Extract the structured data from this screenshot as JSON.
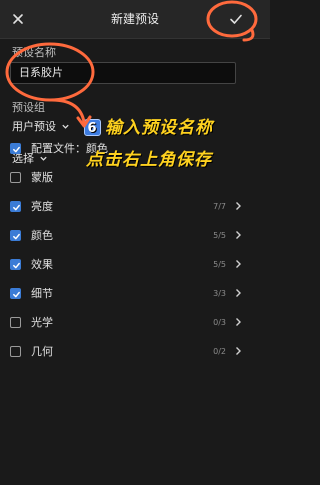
{
  "header": {
    "title": "新建预设"
  },
  "preset_name": {
    "label": "预设名称",
    "value": "日系胶片"
  },
  "preset_group": {
    "label": "预设组",
    "value": "用户预设"
  },
  "select": {
    "label": "选择"
  },
  "options": [
    {
      "label": "配置文件：颜色",
      "checked": true,
      "count": ""
    },
    {
      "label": "蒙版",
      "checked": false,
      "count": ""
    },
    {
      "label": "亮度",
      "checked": true,
      "count": "7/7"
    },
    {
      "label": "颜色",
      "checked": true,
      "count": "5/5"
    },
    {
      "label": "效果",
      "checked": true,
      "count": "5/5"
    },
    {
      "label": "细节",
      "checked": true,
      "count": "3/3"
    },
    {
      "label": "光学",
      "checked": false,
      "count": "0/3"
    },
    {
      "label": "几何",
      "checked": false,
      "count": "0/2"
    }
  ],
  "overlay": {
    "badge": "6",
    "line1": "输入预设名称",
    "line2": "点击右上角保存"
  },
  "colors": {
    "accent": "#3b7cd6",
    "annotation": "#ff6a3d",
    "overlay_text": "#ffd21f"
  }
}
